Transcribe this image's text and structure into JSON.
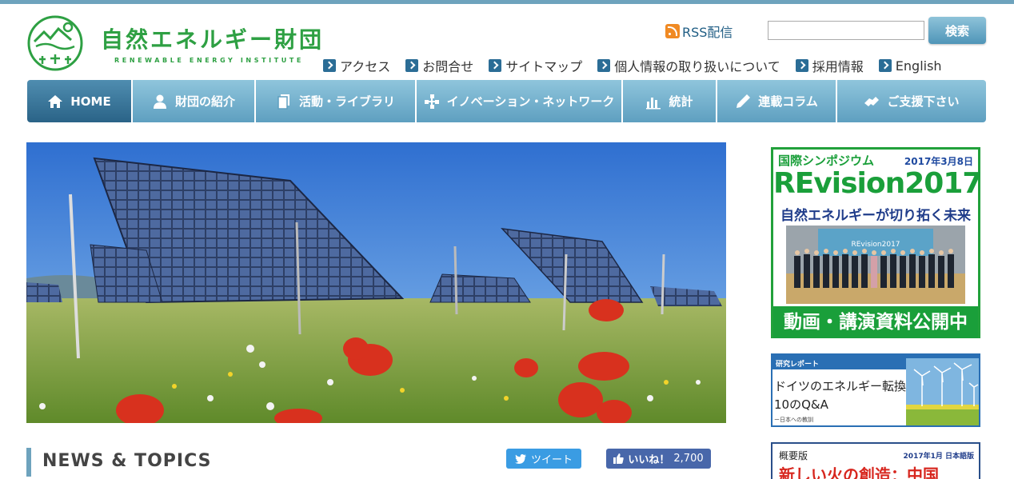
{
  "logo": {
    "title": "自然エネルギー財団",
    "subtitle": "RENEWABLE ENERGY INSTITUTE"
  },
  "header": {
    "rss_label": "RSS配信",
    "search_value": "",
    "search_button": "検索"
  },
  "util_links": [
    {
      "label": "アクセス"
    },
    {
      "label": "お問合せ"
    },
    {
      "label": "サイトマップ"
    },
    {
      "label": "個人情報の取り扱いについて"
    },
    {
      "label": "採用情報"
    },
    {
      "label": "English"
    }
  ],
  "nav": [
    {
      "label": "HOME",
      "icon": "home-icon",
      "active": true
    },
    {
      "label": "財団の紹介",
      "icon": "person-icon"
    },
    {
      "label": "活動・ライブラリ",
      "icon": "documents-icon"
    },
    {
      "label": "イノベーション・ネットワーク",
      "icon": "network-icon"
    },
    {
      "label": "統計",
      "icon": "bar-chart-icon"
    },
    {
      "label": "連載コラム",
      "icon": "pen-icon"
    },
    {
      "label": "ご支援下さい",
      "icon": "handshake-icon"
    }
  ],
  "sidebar": {
    "symposium": {
      "label": "国際シンポジウム",
      "date": "2017年3月8日",
      "title": "REvision2017",
      "subtitle": "自然エネルギーが切り拓く未来",
      "cta": "動画・講演資料公開中",
      "screen_text": "REvision2017"
    },
    "report": {
      "header": "研究レポート",
      "title_line1": "ドイツのエネルギー転換",
      "title_line2": "10のQ&A",
      "footer": "ー日本への教訓"
    },
    "summary": {
      "label": "概要版",
      "date": "2017年1月 日本語版",
      "title": "新しい火の創造：中国"
    }
  },
  "news": {
    "title": "NEWS & TOPICS",
    "tweet_label": "ツイート",
    "like_label": "いいね！",
    "like_count": "2,700"
  },
  "colors": {
    "brand_green": "#2ea043",
    "nav_blue": "#5e9fc0",
    "nav_active": "#2a6387",
    "accent_bar": "#6ea3bd",
    "banner_green": "#1a9f3a"
  }
}
